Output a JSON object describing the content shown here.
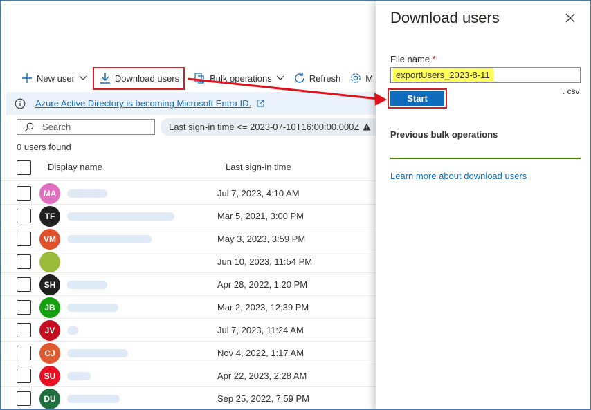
{
  "toolbar": {
    "new_user": "New user",
    "download_users": "Download users",
    "bulk_operations": "Bulk operations",
    "refresh": "Refresh",
    "more": "M"
  },
  "banner": {
    "text": "Azure Active Directory is becoming Microsoft Entra ID."
  },
  "search": {
    "placeholder": "Search"
  },
  "filter": {
    "text": "Last sign-in time <= 2023-07-10T16:00:00.000Z"
  },
  "count_text": "0 users found",
  "table": {
    "col_display_name": "Display name",
    "col_last_signin": "Last sign-in time",
    "rows": [
      {
        "initials": "MA",
        "color": "#e06fc0",
        "signin": "Jul 7, 2023, 4:10 AM"
      },
      {
        "initials": "TF",
        "color": "#1f1f1f",
        "signin": "Mar 5, 2021, 3:00 PM"
      },
      {
        "initials": "VM",
        "color": "#e0502a",
        "signin": "May 3, 2023, 3:59 PM"
      },
      {
        "initials": "",
        "color": "#9aba3a",
        "signin": "Jun 10, 2023, 11:54 PM"
      },
      {
        "initials": "SH",
        "color": "#1f1f1f",
        "signin": "Apr 28, 2022, 1:20 PM"
      },
      {
        "initials": "JB",
        "color": "#13a10e",
        "signin": "Mar 2, 2023, 12:39 PM"
      },
      {
        "initials": "JV",
        "color": "#c50f1f",
        "signin": "Jul 7, 2023, 11:24 AM"
      },
      {
        "initials": "CJ",
        "color": "#e05a30",
        "signin": "Nov 4, 2022, 1:17 AM"
      },
      {
        "initials": "SU",
        "color": "#e81123",
        "signin": "Apr 22, 2023, 2:28 AM"
      },
      {
        "initials": "DU",
        "color": "#1e6e3e",
        "signin": "Sep 25, 2022, 7:59 PM"
      }
    ]
  },
  "pane": {
    "title": "Download users",
    "file_name_label": "File name",
    "required_mark": "*",
    "file_name_value": "exportUsers_2023-8-11",
    "extension": ". csv",
    "start_label": "Start",
    "previous_title": "Previous bulk operations",
    "learn_more": "Learn more about download users"
  },
  "colors": {
    "accent": "#0f6cbd",
    "highlight_red": "#d0202a",
    "success_green": "#498205"
  }
}
